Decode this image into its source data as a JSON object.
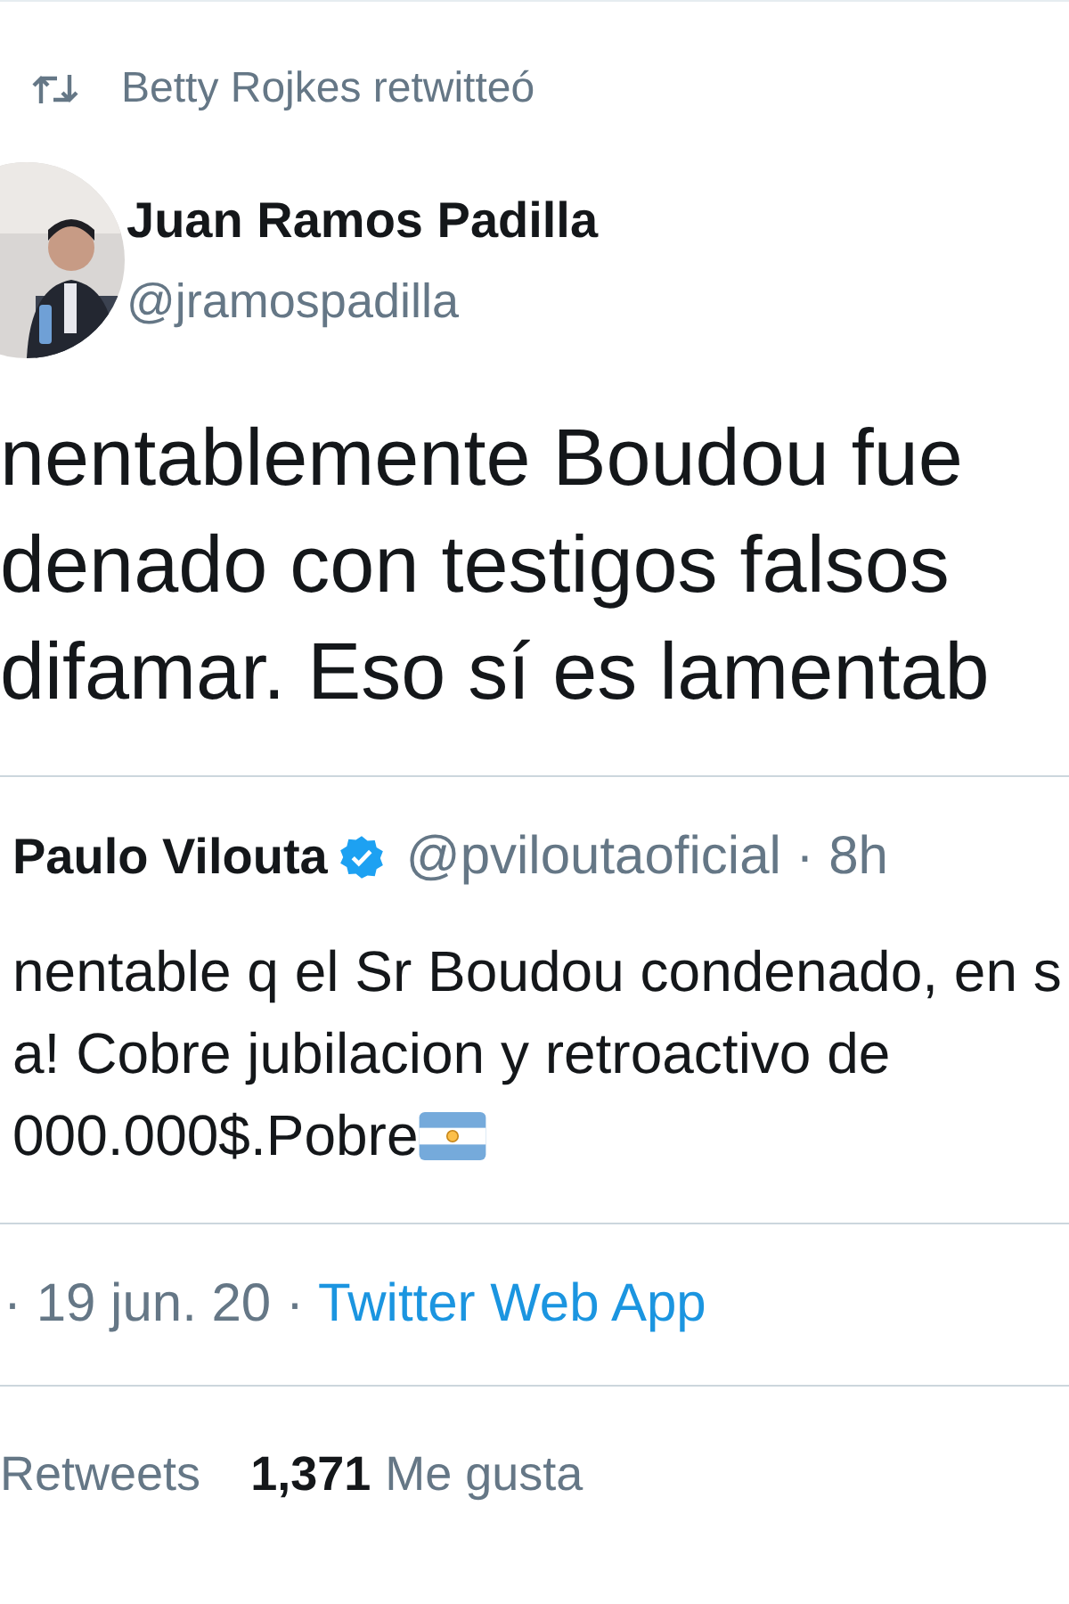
{
  "retweet_header": {
    "text": "Betty Rojkes retwitteó"
  },
  "author": {
    "name": "Juan Ramos Padilla",
    "handle": "@jramospadilla"
  },
  "text_lines": [
    "nentablemente Boudou fue",
    "denado con testigos falsos",
    "difamar. Eso sí es lamentab"
  ],
  "quoted_tweet": {
    "name": "Paulo Vilouta",
    "verified": true,
    "handle": "@pviloutaoficial · 8h",
    "text_lines": [
      "nentable q el Sr Boudou condenado, en s",
      "a! Cobre jubilacion y retroactivo de",
      "000.000$.Pobre"
    ],
    "flag_emoji": true
  },
  "meta": {
    "date": "· 19 jun. 20 ·",
    "source": "Twitter Web App"
  },
  "stats": [
    {
      "label": "Retweets"
    },
    {
      "count": "1,371",
      "label": "Me gusta"
    }
  ]
}
